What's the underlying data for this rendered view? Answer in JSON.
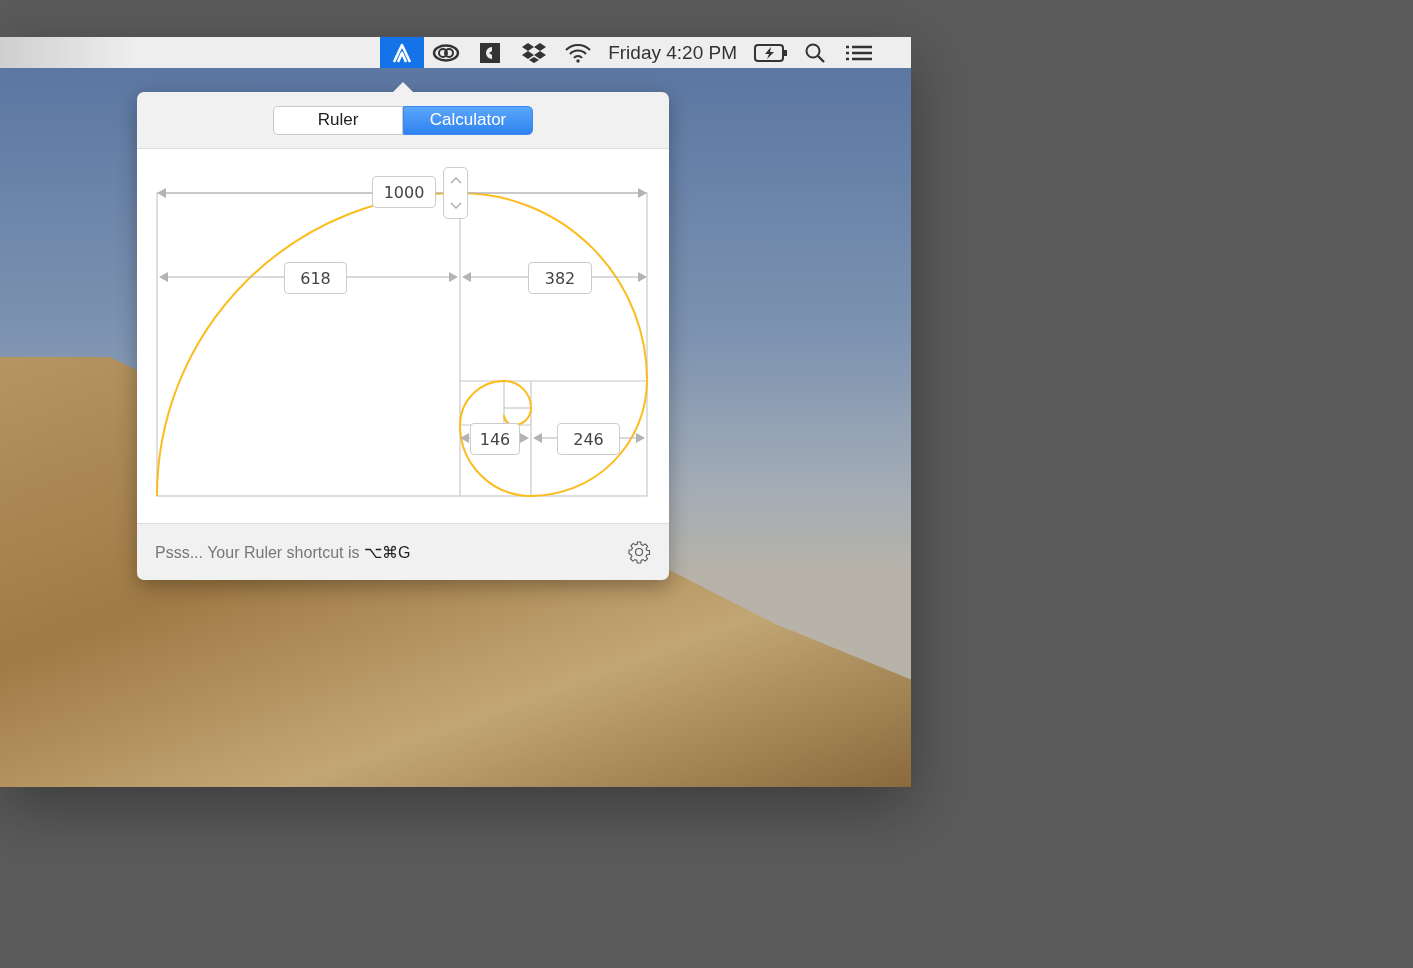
{
  "menubar": {
    "extras": [
      {
        "kind": "app",
        "selected": true
      },
      {
        "kind": "creative-cloud",
        "selected": false
      },
      {
        "kind": "cardhop",
        "selected": false
      },
      {
        "kind": "dropbox",
        "selected": false
      },
      {
        "kind": "wifi",
        "selected": false
      }
    ],
    "clock": "Friday 4:20 PM",
    "trailing": [
      {
        "kind": "battery"
      },
      {
        "kind": "search"
      },
      {
        "kind": "list"
      }
    ]
  },
  "popover": {
    "tabs": [
      {
        "label": "Ruler",
        "selected": false
      },
      {
        "label": "Calculator",
        "selected": true
      }
    ],
    "total": {
      "value": "1000"
    },
    "segments": [
      {
        "value": "618"
      },
      {
        "value": "382"
      },
      {
        "value": "146"
      },
      {
        "value": "246"
      }
    ],
    "footer": "Psss... Your Ruler shortcut is **⌥⌘G**"
  }
}
